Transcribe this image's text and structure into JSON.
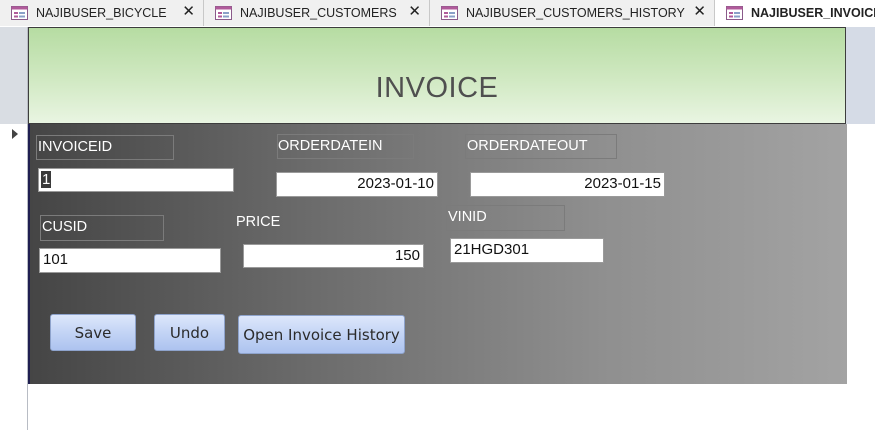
{
  "tabs": [
    {
      "label": "NAJIBUSER_BICYCLE",
      "close": "✕",
      "active": false
    },
    {
      "label": "NAJIBUSER_CUSTOMERS",
      "close": "✕",
      "active": false
    },
    {
      "label": "NAJIBUSER_CUSTOMERS_HISTORY",
      "close": "✕",
      "active": false
    },
    {
      "label": "NAJIBUSER_INVOICE",
      "active": true
    }
  ],
  "form": {
    "title": "INVOICE",
    "fields": {
      "invoiceid": {
        "label": "INVOICEID",
        "value": "1"
      },
      "orderdatein": {
        "label": "ORDERDATEIN",
        "value": "2023-01-10"
      },
      "orderdateout": {
        "label": "ORDERDATEOUT",
        "value": "2023-01-15"
      },
      "cusid": {
        "label": "CUSID",
        "value": "101"
      },
      "price": {
        "label": "PRICE",
        "value": "150"
      },
      "vinid": {
        "label": "VINID",
        "value": "21HGD301"
      }
    },
    "buttons": {
      "save": "Save",
      "undo": "Undo",
      "open_history": "Open Invoice History"
    }
  },
  "icons": {
    "tab_icon": "form-icon",
    "record_selector": "current-record-arrow-icon"
  },
  "colors": {
    "header_green": "#b6dca2",
    "button_blue": "#c3d4f5",
    "detail_dark": "#454545"
  }
}
